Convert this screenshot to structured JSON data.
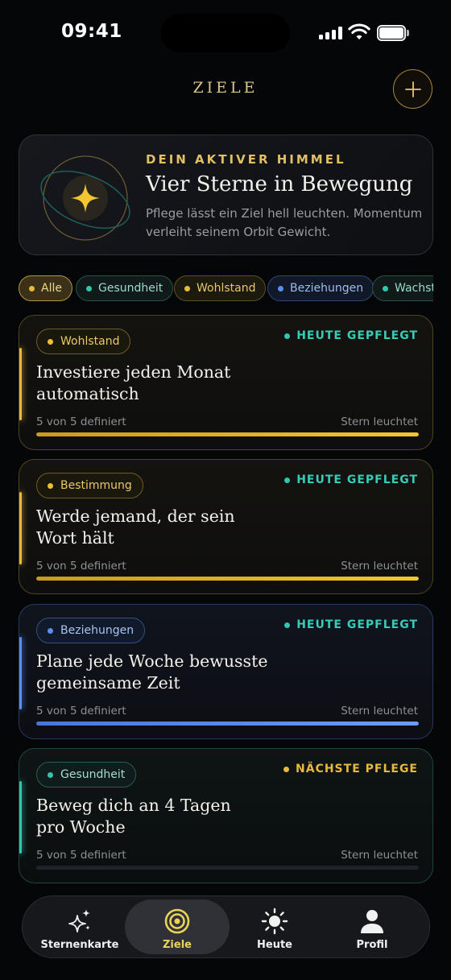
{
  "status_bar": {
    "time": "09:41"
  },
  "header": {
    "title": "ZIELE",
    "add_icon": "plus-icon"
  },
  "hero": {
    "eyebrow": "DEIN AKTIVER HIMMEL",
    "title": "Vier Sterne in Bewegung",
    "subtitle": "Pflege lässt ein Ziel hell leuchten. Momentum verleiht seinem Orbit Gewicht.",
    "icon": "star-orbit-icon"
  },
  "filters": [
    {
      "label": "Alle",
      "color": "#e8b93a",
      "selected": true
    },
    {
      "label": "Gesundheit",
      "color": "#2fc7b0",
      "selected": false
    },
    {
      "label": "Wohlstand",
      "color": "#e8b93a",
      "selected": false
    },
    {
      "label": "Beziehungen",
      "color": "#5b8ef0",
      "selected": false
    },
    {
      "label": "Wachstum",
      "color": "#2fc7b0",
      "selected": false
    }
  ],
  "goals": [
    {
      "category": "Wohlstand",
      "status": "HEUTE GEPFLEGT",
      "title": "Investiere jeden Monat automatisch",
      "progress_text": "5 von 5 definiert",
      "shine_text": "Stern leuchtet",
      "progress": 1.0,
      "color": "#e8b93a",
      "status_color": "#2fc7b0"
    },
    {
      "category": "Bestimmung",
      "status": "HEUTE GEPFLEGT",
      "title": "Werde jemand, der sein Wort hält",
      "progress_text": "5 von 5 definiert",
      "shine_text": "Stern leuchtet",
      "progress": 1.0,
      "color": "#e8b93a",
      "status_color": "#2fc7b0"
    },
    {
      "category": "Beziehungen",
      "status": "HEUTE GEPFLEGT",
      "title": "Plane jede Woche bewusste gemeinsame Zeit",
      "progress_text": "5 von 5 definiert",
      "shine_text": "Stern leuchtet",
      "progress": 1.0,
      "color": "#5b8ef0",
      "status_color": "#2fc7b0"
    },
    {
      "category": "Gesundheit",
      "status": "NÄCHSTE PFLEGE",
      "title": "Beweg dich an 4 Tagen pro Woche",
      "progress_text": "5 von 5 definiert",
      "shine_text": "Stern leuchtet",
      "progress": 0.0,
      "color": "#2fc7b0",
      "status_color": "#e8b93a"
    }
  ],
  "tabs": [
    {
      "label": "Sternenkarte",
      "icon": "sparkles-icon",
      "active": false
    },
    {
      "label": "Ziele",
      "icon": "target-icon",
      "active": true
    },
    {
      "label": "Heute",
      "icon": "sun-icon",
      "active": false
    },
    {
      "label": "Profil",
      "icon": "person-icon",
      "active": false
    }
  ]
}
